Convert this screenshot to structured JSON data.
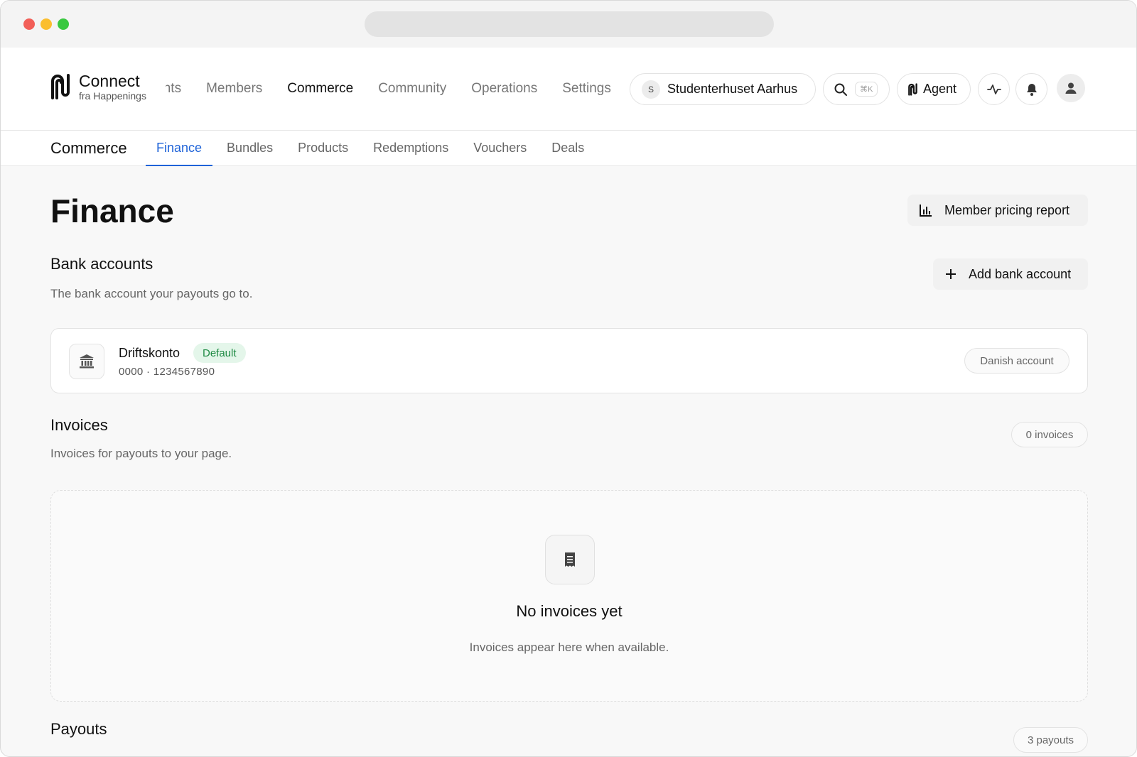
{
  "brand": {
    "title": "Connect",
    "subtitle": "fra Happenings"
  },
  "main_nav": {
    "items": [
      {
        "label": "Events"
      },
      {
        "label": "Members"
      },
      {
        "label": "Commerce"
      },
      {
        "label": "Community"
      },
      {
        "label": "Operations"
      },
      {
        "label": "Settings"
      }
    ],
    "active": "Commerce"
  },
  "org": {
    "initial": "S",
    "name": "Studenterhuset Aarhus"
  },
  "search": {
    "shortcut": "⌘K"
  },
  "agent": {
    "label": "Agent"
  },
  "icons": {
    "search": "search-icon",
    "agent": "agent-logo-icon",
    "activity": "activity-icon",
    "bell": "bell-icon",
    "user": "user-icon",
    "bank": "bank-icon",
    "receipt": "receipt-icon",
    "chart": "bar-chart-icon",
    "plus": "plus-icon"
  },
  "sub_nav": {
    "section": "Commerce",
    "tabs": [
      {
        "label": "Finance"
      },
      {
        "label": "Bundles"
      },
      {
        "label": "Products"
      },
      {
        "label": "Redemptions"
      },
      {
        "label": "Vouchers"
      },
      {
        "label": "Deals"
      }
    ],
    "active": "Finance"
  },
  "page": {
    "title": "Finance",
    "report_button": "Member pricing report"
  },
  "bank_accounts": {
    "title": "Bank accounts",
    "description": "The bank account your payouts go to.",
    "add_button": "Add bank account",
    "account": {
      "name": "Driftskonto",
      "badge": "Default",
      "number": "0000 · 1234567890",
      "type": "Danish account"
    }
  },
  "invoices": {
    "title": "Invoices",
    "description": "Invoices for payouts to your page.",
    "count": "0 invoices",
    "empty_title": "No invoices yet",
    "empty_description": "Invoices appear here when available."
  },
  "payouts": {
    "title": "Payouts",
    "count": "3 payouts"
  },
  "colors": {
    "accent": "#1f63d8",
    "badge_bg": "#e4f6ea",
    "badge_text": "#1e8a43"
  }
}
